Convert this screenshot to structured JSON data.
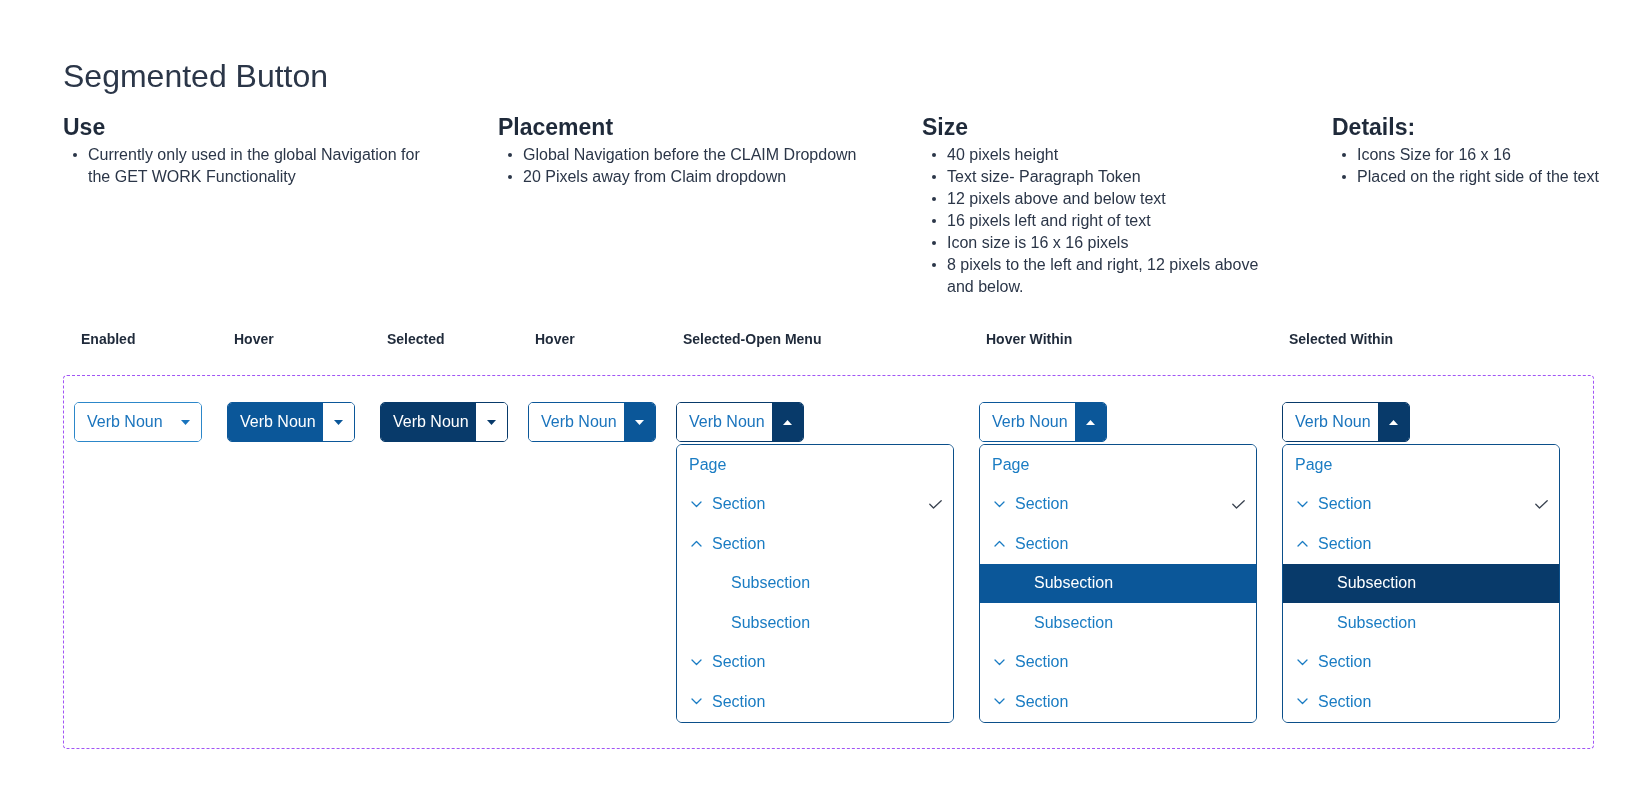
{
  "title": "Segmented Button",
  "info_sections": [
    {
      "heading": "Use",
      "bullets": [
        "Currently only used in the global Navigation for the GET WORK Functionality"
      ]
    },
    {
      "heading": "Placement",
      "bullets": [
        "Global Navigation before the CLAIM Dropdown",
        "20 Pixels away from Claim dropdown"
      ]
    },
    {
      "heading": "Size",
      "bullets": [
        "40 pixels height",
        "Text size- Paragraph Token",
        "12 pixels above and below text",
        "16 pixels left and right of text",
        "Icon size is 16 x 16 pixels",
        "8 pixels to the left and right, 12 pixels above and below."
      ]
    },
    {
      "heading": "Details:",
      "bullets": [
        "Icons Size for 16 x 16",
        "Placed on the right side of the text"
      ]
    }
  ],
  "variants": [
    {
      "label": "Enabled",
      "button": {
        "text": "Verb Noun",
        "text_hovered": false,
        "text_selected": false,
        "caret_hovered": false,
        "caret_selected": false,
        "expanded": false
      }
    },
    {
      "label": "Hover",
      "button": {
        "text": "Verb Noun",
        "text_hovered": true,
        "text_selected": false,
        "caret_hovered": false,
        "caret_selected": false,
        "expanded": false
      }
    },
    {
      "label": "Selected",
      "button": {
        "text": "Verb Noun",
        "text_hovered": false,
        "text_selected": true,
        "caret_hovered": false,
        "caret_selected": false,
        "expanded": false
      }
    },
    {
      "label": "Hover",
      "button": {
        "text": "Verb Noun",
        "text_hovered": false,
        "text_selected": false,
        "caret_hovered": true,
        "caret_selected": false,
        "expanded": false
      }
    },
    {
      "label": "Selected-Open Menu",
      "button": {
        "text": "Verb Noun",
        "text_hovered": false,
        "text_selected": false,
        "caret_hovered": false,
        "caret_selected": true,
        "expanded": true
      },
      "menu": {
        "items": [
          {
            "kind": "page",
            "label": "Page",
            "checked": false,
            "selected": false,
            "hovered": false
          },
          {
            "kind": "section",
            "label": "Section",
            "expanded": false,
            "checked": true,
            "selected": false,
            "hovered": false
          },
          {
            "kind": "section",
            "label": "Section",
            "expanded": true,
            "checked": false,
            "selected": false,
            "hovered": false,
            "children": [
              {
                "kind": "subsection",
                "label": "Subsection",
                "checked": false,
                "selected": false,
                "hovered": false
              },
              {
                "kind": "subsection",
                "label": "Subsection",
                "checked": false,
                "selected": false,
                "hovered": false
              }
            ]
          },
          {
            "kind": "section",
            "label": "Section",
            "expanded": false,
            "checked": false,
            "selected": false,
            "hovered": false
          },
          {
            "kind": "section",
            "label": "Section",
            "expanded": false,
            "checked": false,
            "selected": false,
            "hovered": false
          }
        ]
      }
    },
    {
      "label": "Hover Within",
      "button": {
        "text": "Verb Noun",
        "text_hovered": false,
        "text_selected": false,
        "caret_hovered": true,
        "caret_selected": false,
        "expanded": true
      },
      "menu": {
        "items": [
          {
            "kind": "page",
            "label": "Page",
            "checked": false,
            "selected": false,
            "hovered": false
          },
          {
            "kind": "section",
            "label": "Section",
            "expanded": false,
            "checked": true,
            "selected": false,
            "hovered": false
          },
          {
            "kind": "section",
            "label": "Section",
            "expanded": true,
            "checked": false,
            "selected": false,
            "hovered": false,
            "children": [
              {
                "kind": "subsection",
                "label": "Subsection",
                "checked": false,
                "selected": false,
                "hovered": true
              },
              {
                "kind": "subsection",
                "label": "Subsection",
                "checked": false,
                "selected": false,
                "hovered": false
              }
            ]
          },
          {
            "kind": "section",
            "label": "Section",
            "expanded": false,
            "checked": false,
            "selected": false,
            "hovered": false
          },
          {
            "kind": "section",
            "label": "Section",
            "expanded": false,
            "checked": false,
            "selected": false,
            "hovered": false
          }
        ]
      }
    },
    {
      "label": "Selected Within",
      "button": {
        "text": "Verb Noun",
        "text_hovered": false,
        "text_selected": false,
        "caret_hovered": false,
        "caret_selected": true,
        "expanded": true
      },
      "menu": {
        "items": [
          {
            "kind": "page",
            "label": "Page",
            "checked": false,
            "selected": false,
            "hovered": false
          },
          {
            "kind": "section",
            "label": "Section",
            "expanded": false,
            "checked": true,
            "selected": false,
            "hovered": false
          },
          {
            "kind": "section",
            "label": "Section",
            "expanded": true,
            "checked": false,
            "selected": false,
            "hovered": false,
            "children": [
              {
                "kind": "subsection",
                "label": "Subsection",
                "checked": false,
                "selected": true,
                "hovered": false
              },
              {
                "kind": "subsection",
                "label": "Subsection",
                "checked": false,
                "selected": false,
                "hovered": false
              }
            ]
          },
          {
            "kind": "section",
            "label": "Section",
            "expanded": false,
            "checked": false,
            "selected": false,
            "hovered": false
          },
          {
            "kind": "section",
            "label": "Section",
            "expanded": false,
            "checked": false,
            "selected": false,
            "hovered": false
          }
        ]
      }
    }
  ]
}
